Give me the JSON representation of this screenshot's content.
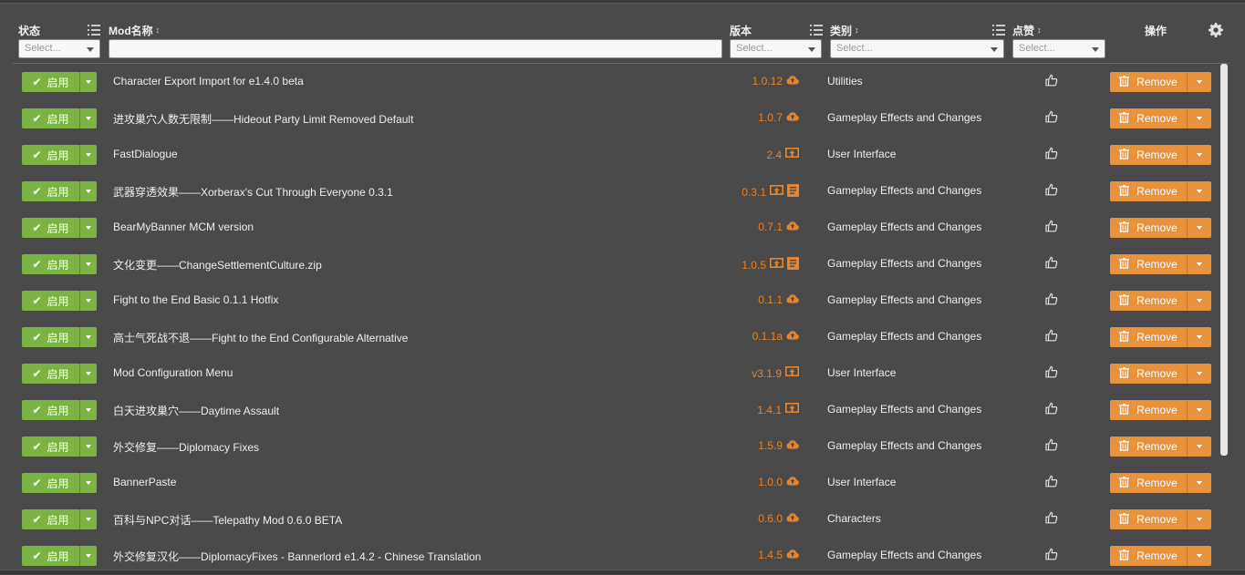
{
  "header": {
    "status": "状态",
    "mod_name": "Mod名称",
    "version": "版本",
    "category": "类别",
    "likes": "点赞",
    "actions": "操作",
    "select_placeholder": "Select..."
  },
  "colors": {
    "enable": "#7cb342",
    "remove": "#e8923c",
    "version": "#e8842a"
  },
  "enable_label": "启用",
  "remove_label": "Remove",
  "rows": [
    {
      "name": "Character Export Import for e1.4.0 beta",
      "version": "1.0.12",
      "icons": [
        "cloud-icon"
      ],
      "category": "Utilities"
    },
    {
      "name": "进攻巢穴人数无限制——Hideout Party Limit Removed Default",
      "version": "1.0.7",
      "icons": [
        "cloud-icon"
      ],
      "category": "Gameplay Effects and Changes"
    },
    {
      "name": "FastDialogue",
      "version": "2.4",
      "icons": [
        "upload-box-icon"
      ],
      "category": "User Interface"
    },
    {
      "name": "武器穿透效果——Xorberax's Cut Through Everyone 0.3.1",
      "version": "0.3.1",
      "icons": [
        "upload-box-icon",
        "document-icon"
      ],
      "category": "Gameplay Effects and Changes"
    },
    {
      "name": "BearMyBanner MCM version",
      "version": "0.7.1",
      "icons": [
        "cloud-icon"
      ],
      "category": "Gameplay Effects and Changes"
    },
    {
      "name": "文化变更——ChangeSettlementCulture.zip",
      "version": "1.0.5",
      "icons": [
        "upload-box-icon",
        "document-icon"
      ],
      "category": "Gameplay Effects and Changes"
    },
    {
      "name": "Fight to the End Basic 0.1.1 Hotfix",
      "version": "0.1.1",
      "icons": [
        "cloud-icon"
      ],
      "category": "Gameplay Effects and Changes"
    },
    {
      "name": "高士气死战不退——Fight to the End Configurable Alternative",
      "version": "0.1.1a",
      "icons": [
        "cloud-icon"
      ],
      "category": "Gameplay Effects and Changes"
    },
    {
      "name": "Mod Configuration Menu",
      "version": "v3.1.9",
      "icons": [
        "upload-box-icon"
      ],
      "category": "User Interface"
    },
    {
      "name": "白天进攻巢穴——Daytime Assault",
      "version": "1.4.1",
      "icons": [
        "upload-box-icon"
      ],
      "category": "Gameplay Effects and Changes"
    },
    {
      "name": "外交修复——Diplomacy Fixes",
      "version": "1.5.9",
      "icons": [
        "cloud-icon"
      ],
      "category": "Gameplay Effects and Changes"
    },
    {
      "name": "BannerPaste",
      "version": "1.0.0",
      "icons": [
        "cloud-icon"
      ],
      "category": "User Interface"
    },
    {
      "name": "百科与NPC对话——Telepathy Mod 0.6.0 BETA",
      "version": "0.6.0",
      "icons": [
        "cloud-icon"
      ],
      "category": "Characters"
    },
    {
      "name": "外交修复汉化——DiplomacyFixes - Bannerlord e1.4.2 - Chinese Translation",
      "version": "1.4.5",
      "icons": [
        "cloud-icon"
      ],
      "category": "Gameplay Effects and Changes"
    }
  ]
}
